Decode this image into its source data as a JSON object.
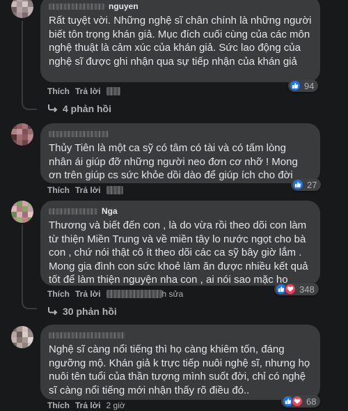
{
  "comments": [
    {
      "author": "nguyen",
      "text": "Rất tuyệt vời. Những nghệ sĩ chân chính là những người biết tôn trọng khán giả. Mục đích cuối cùng của các môn nghệ thuật là cảm xúc của khán giả. Sức lao động của nghệ sĩ được ghi nhận qua sự tiếp nhận của khán giả",
      "like": "Thích",
      "reply": "Trả lời",
      "reactions": "94",
      "replies": "4 phản hồi"
    },
    {
      "author": "",
      "text": "Thủy Tiên là một ca sỹ có tâm có tài và có tấm lòng nhân ái giúp đỡ những người neo đơn cơ nhỡ ! Mong ơn trên giúp cs sức khỏe dồi dào để giúp ích cho đời",
      "like": "Thích",
      "reply": "Trả lời",
      "reactions": "27"
    },
    {
      "author": "Nga",
      "text": "Thương và biết đến con , là do vừa rồi theo dõi con làm từ thiện Miền Trung và về miền tây lo nước ngọt cho bà con , chứ nói thật cô ít theo dõi các ca sỹ bây giờ lắm . Mong gia đình con sức khoẻ làm ăn được nhiều kết quả tốt để làm thiện nguyện nha con , ai nói sao mặc họ",
      "like": "Thích",
      "reply": "Trả lời",
      "edited": "h sửa",
      "reactions": "348",
      "replies": "30 phản hồi"
    },
    {
      "author": "",
      "text": "Nghệ sĩ càng nổi tiếng thì họ càng khiêm tốn, đáng ngưỡng mộ. Khán giả k trực tiếp nuôi nghệ sĩ, nhưng họ nuôi tên tuổi của thần tượng mình suốt đời, chỉ có nghệ sĩ càng nổi tiếng mới nhận thấy rõ điều đó..",
      "like": "Thích",
      "reply": "Trả lời",
      "time": "2 giờ",
      "reactions": "68"
    }
  ],
  "colors": {
    "background": "#18191a",
    "bubble": "#3a3b3c",
    "like": "#1877f2",
    "love": "#f33e58"
  },
  "icons": [
    "like-icon",
    "love-icon",
    "reply-arrow-icon"
  ]
}
